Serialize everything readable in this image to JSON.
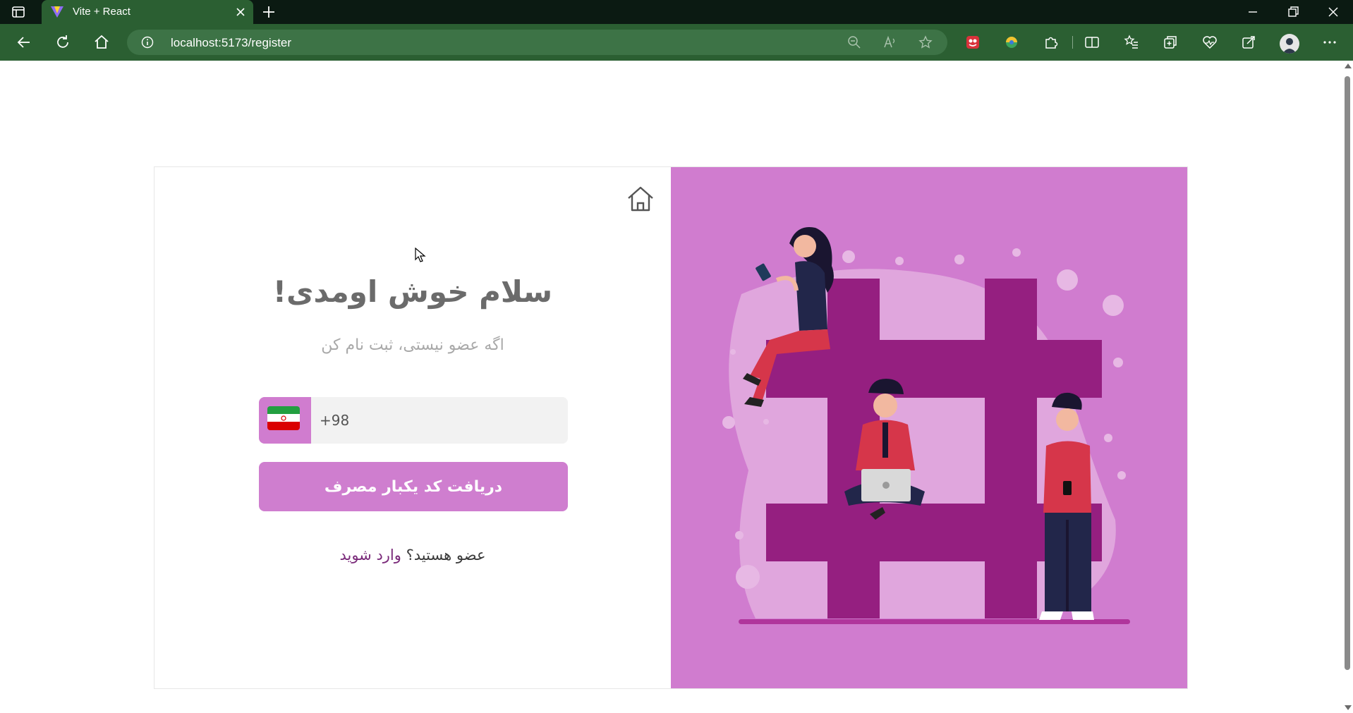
{
  "browser": {
    "tab_title": "Vite + React",
    "url": "localhost:5173/register"
  },
  "page": {
    "title": "سلام خوش اومدی!",
    "subtitle": "اگه عضو نیستی، ثبت نام کن",
    "phone": {
      "country_code": "+98",
      "flag": "iran-flag-icon"
    },
    "otp_button_label": "دریافت کد یکبار مصرف",
    "login_prompt": "عضو هستید؟",
    "login_link_label": "وارد شوید"
  },
  "colors": {
    "browser_frame": "#0b1a12",
    "browser_toolbar": "#2b5f32",
    "accent": "#cf7ecf",
    "illustration_bg": "#d07ccf",
    "illustration_dark": "#951f80",
    "login_link": "#7a2a7a"
  }
}
